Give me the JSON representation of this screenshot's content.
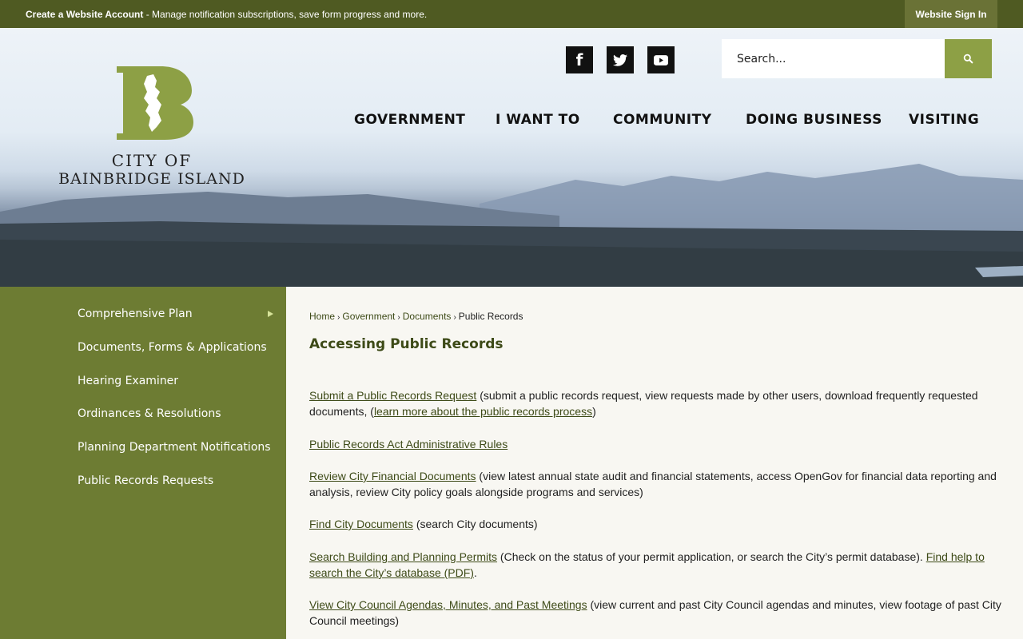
{
  "topbar": {
    "promo_bold": "Create a Website Account",
    "promo_text": " - Manage notification subscriptions, save form progress and more.",
    "signin_label": "Website Sign In"
  },
  "logo": {
    "line1": "CITY OF",
    "line2": "BAINBRIDGE ISLAND"
  },
  "social": {
    "facebook": "f",
    "twitter": "twitter-icon",
    "youtube": "youtube-icon"
  },
  "search": {
    "placeholder": "Search..."
  },
  "nav": [
    "GOVERNMENT",
    "I WANT TO",
    "COMMUNITY",
    "DOING BUSINESS",
    "VISITING"
  ],
  "sidebar": {
    "items": [
      "Comprehensive Plan",
      "Documents, Forms & Applications",
      "Hearing Examiner",
      "Ordinances & Resolutions",
      "Planning Department Notifications",
      "Public Records Requests"
    ]
  },
  "breadcrumb": [
    "Home",
    "Government",
    "Documents",
    "Public Records"
  ],
  "page_title": "Accessing Public Records",
  "paragraphs": {
    "p1": {
      "link": "Submit a Public Records Request",
      "text1": " (submit a public records request, view requests made by other users, download frequently requested documents, (",
      "link2": "learn more about the public records process",
      "text2": ")"
    },
    "p2": {
      "link": "Public Records Act Administrative Rules"
    },
    "p3": {
      "link": "Review City Financial Documents",
      "text": " (view latest annual state audit and financial statements, access OpenGov for financial data reporting and analysis, review City policy goals alongside programs and services)"
    },
    "p4": {
      "link": "Find City Documents",
      "text": " (search City documents)"
    },
    "p5": {
      "link": "Search Building and Planning Permits",
      "text1": " (Check on the status of your permit application, or search the City’s permit database). ",
      "link2": "Find help to search the City’s database (PDF)",
      "text2": "."
    },
    "p6": {
      "link": "View City Council Agendas, Minutes, and Past Meetings",
      "text": " (view current and past City Council agendas and minutes, view footage of past City Council meetings)"
    }
  },
  "colors": {
    "topbar": "#4f5a22",
    "sidebar": "#6d7c33",
    "accent": "#8da045",
    "link": "#3d4a17"
  }
}
